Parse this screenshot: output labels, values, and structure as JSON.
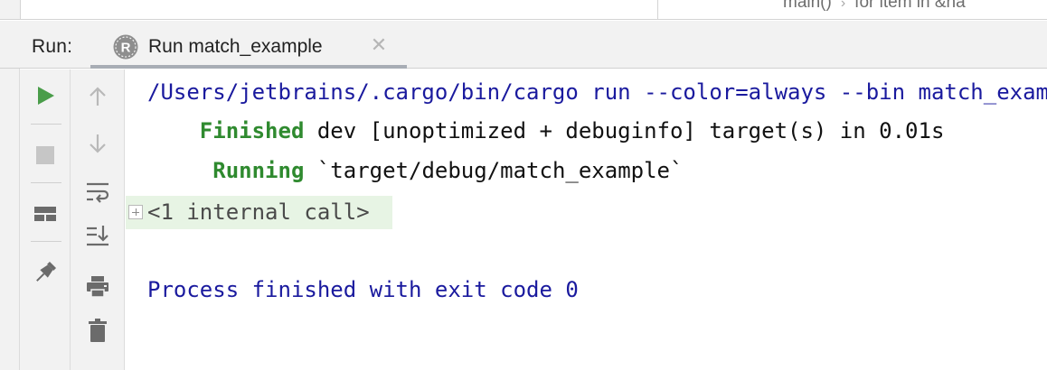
{
  "editor": {
    "breadcrumb": [
      "main()",
      "for item in &na"
    ]
  },
  "run_panel": {
    "label": "Run:",
    "tab_title": "Run match_example",
    "tab_icon": "rust-icon"
  },
  "toolbar_left": [
    {
      "name": "rerun-button",
      "icon": "play-icon"
    },
    {
      "name": "stop-button",
      "icon": "stop-icon"
    },
    {
      "name": "layout-button",
      "icon": "layout-icon"
    },
    {
      "name": "pin-tab-button",
      "icon": "pin-icon"
    }
  ],
  "toolbar_right": [
    {
      "name": "up-stack-button",
      "icon": "arrow-up-icon"
    },
    {
      "name": "down-stack-button",
      "icon": "arrow-down-icon"
    },
    {
      "name": "soft-wrap-button",
      "icon": "soft-wrap-icon"
    },
    {
      "name": "scroll-to-end-button",
      "icon": "scroll-to-end-icon"
    },
    {
      "name": "print-button",
      "icon": "printer-icon"
    },
    {
      "name": "clear-all-button",
      "icon": "trash-icon"
    }
  ],
  "console": {
    "command": "/Users/jetbrains/.cargo/bin/cargo run --color=always --bin match_example",
    "finished_keyword": "Finished",
    "finished_rest": " dev [unoptimized + debuginfo] target(s) in 0.01s",
    "running_keyword": "Running",
    "running_rest": " `target/debug/match_example`",
    "internal_call": "<1 internal call>",
    "exit_message": "Process finished with exit code 0"
  },
  "colors": {
    "accent_green": "#2f8a2f",
    "console_blue": "#1a1a9e",
    "panel_bg": "#f2f2f2"
  }
}
